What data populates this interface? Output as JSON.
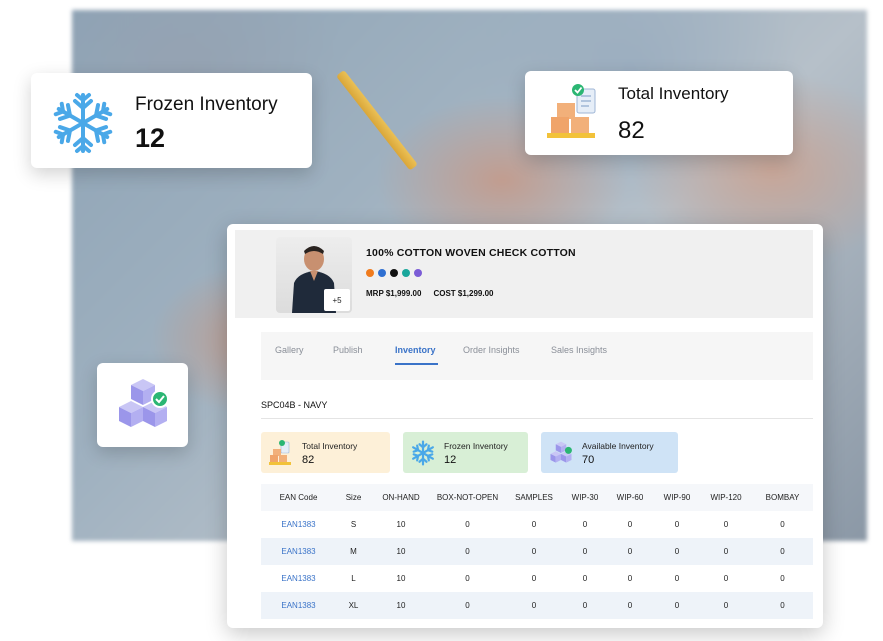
{
  "frozen_card": {
    "title": "Frozen Inventory",
    "value": "12",
    "icon": "snowflake-icon"
  },
  "total_card": {
    "title": "Total Inventory",
    "value": "82",
    "icon": "boxes-checklist-icon"
  },
  "cube_card": {
    "icon": "cubes-check-icon"
  },
  "product": {
    "name": "100% COTTON WOVEN CHECK COTTON",
    "more_images": "+5",
    "colors": [
      "#f07b1d",
      "#2f6fd1",
      "#111111",
      "#1aa79c",
      "#7b5cd6"
    ],
    "mrp": "MRP $1,999.00",
    "cost": "COST $1,299.00"
  },
  "tabs": [
    {
      "label": "Gallery",
      "active": false
    },
    {
      "label": "Publish",
      "active": false
    },
    {
      "label": "Inventory",
      "active": true
    },
    {
      "label": "Order Insights",
      "active": false
    },
    {
      "label": "Sales Insights",
      "active": false
    }
  ],
  "sku": "SPC04B - NAVY",
  "summary": [
    {
      "title": "Total Inventory",
      "value": "82",
      "bg": "#fdf0d8",
      "icon": "boxes-icon"
    },
    {
      "title": "Frozen Inventory",
      "value": "12",
      "bg": "#d8efd6",
      "icon": "snowflake-icon"
    },
    {
      "title": "Available Inventory",
      "value": "70",
      "bg": "#cfe3f6",
      "icon": "cubes-icon"
    }
  ],
  "table": {
    "headers": [
      "EAN Code",
      "Size",
      "ON-HAND",
      "BOX-NOT-OPEN",
      "SAMPLES",
      "WIP-30",
      "WIP-60",
      "WIP-90",
      "WIP-120",
      "BOMBAY"
    ],
    "rows": [
      [
        "EAN1383",
        "S",
        "10",
        "0",
        "0",
        "0",
        "0",
        "0",
        "0",
        "0"
      ],
      [
        "EAN1383",
        "M",
        "10",
        "0",
        "0",
        "0",
        "0",
        "0",
        "0",
        "0"
      ],
      [
        "EAN1383",
        "L",
        "10",
        "0",
        "0",
        "0",
        "0",
        "0",
        "0",
        "0"
      ],
      [
        "EAN1383",
        "XL",
        "10",
        "0",
        "0",
        "0",
        "0",
        "0",
        "0",
        "0"
      ]
    ]
  },
  "colors": {
    "accent": "#3a73c8",
    "snowflake": "#4aa8e8"
  }
}
